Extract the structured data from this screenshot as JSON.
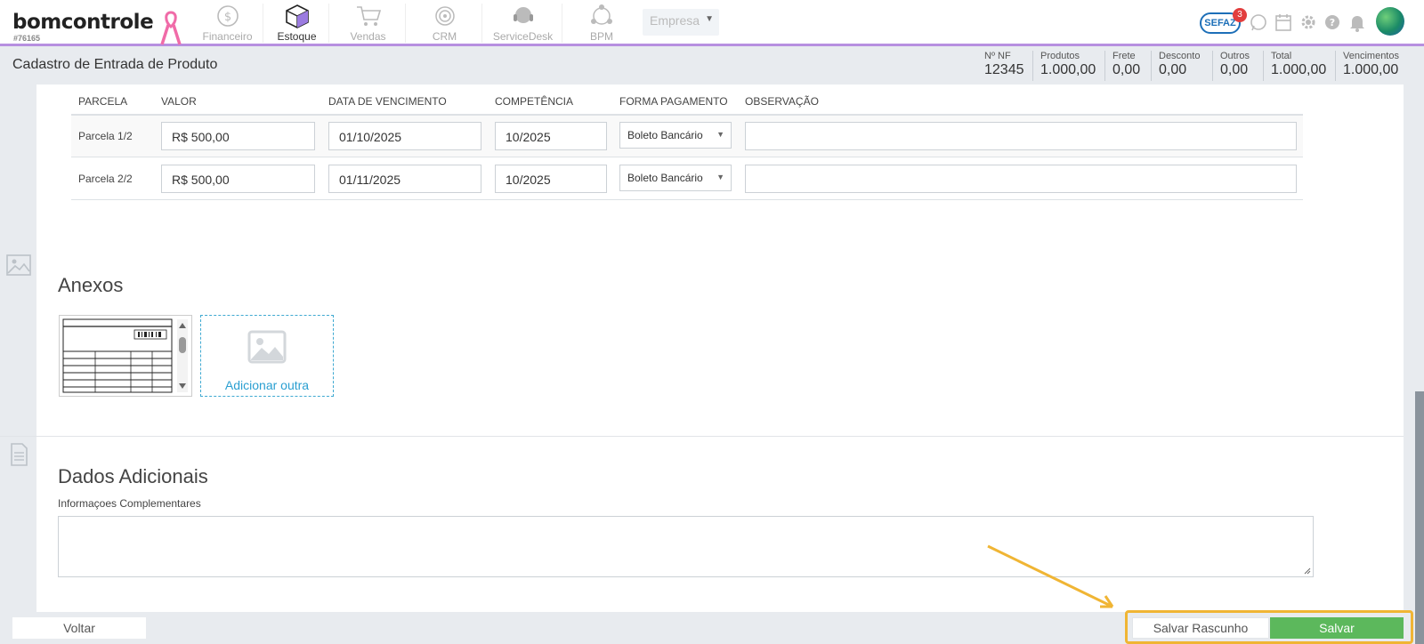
{
  "nav": {
    "logo": "bomcontrole",
    "account_id": "#76165",
    "items": [
      {
        "label": "Financeiro",
        "icon": "dollar-coin-icon",
        "active": false
      },
      {
        "label": "Estoque",
        "icon": "box-icon",
        "active": true
      },
      {
        "label": "Vendas",
        "icon": "cart-icon",
        "active": false
      },
      {
        "label": "CRM",
        "icon": "target-icon",
        "active": false
      },
      {
        "label": "ServiceDesk",
        "icon": "headset-icon",
        "active": false
      },
      {
        "label": "BPM",
        "icon": "workflow-icon",
        "active": false
      }
    ],
    "company_select": "Empresa",
    "sefaz_label": "SEFAZ",
    "sefaz_badge": "3"
  },
  "header": {
    "title": "Cadastro de Entrada de Produto",
    "summary": [
      {
        "label": "Nº NF",
        "value": "12345"
      },
      {
        "label": "Produtos",
        "value": "1.000,00"
      },
      {
        "label": "Frete",
        "value": "0,00"
      },
      {
        "label": "Desconto",
        "value": "0,00"
      },
      {
        "label": "Outros",
        "value": "0,00"
      },
      {
        "label": "Total",
        "value": "1.000,00"
      },
      {
        "label": "Vencimentos",
        "value": "1.000,00"
      }
    ]
  },
  "parcelas": {
    "columns": [
      "PARCELA",
      "VALOR",
      "DATA DE VENCIMENTO",
      "COMPETÊNCIA",
      "FORMA PAGAMENTO",
      "OBSERVAÇÃO"
    ],
    "rows": [
      {
        "parcela": "Parcela 1/2",
        "valor": "R$ 500,00",
        "vencimento": "01/10/2025",
        "competencia": "10/2025",
        "forma": "Boleto Bancário",
        "observacao": ""
      },
      {
        "parcela": "Parcela 2/2",
        "valor": "R$ 500,00",
        "vencimento": "01/11/2025",
        "competencia": "10/2025",
        "forma": "Boleto Bancário",
        "observacao": ""
      }
    ]
  },
  "anexos": {
    "title": "Anexos",
    "add_label": "Adicionar outra"
  },
  "dados": {
    "title": "Dados Adicionais",
    "info_label": "Informaçoes Complementares",
    "info_value": ""
  },
  "footer": {
    "back": "Voltar",
    "draft": "Salvar Rascunho",
    "save": "Salvar"
  },
  "colors": {
    "accent": "#b78fe0",
    "save": "#5cb85c",
    "highlight": "#f0b534",
    "link": "#2a9fd1"
  }
}
